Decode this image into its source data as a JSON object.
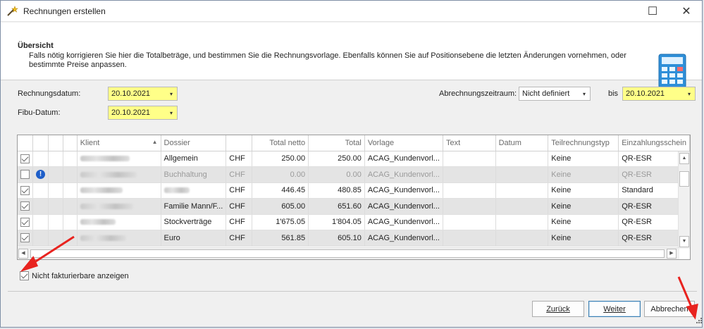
{
  "window": {
    "title": "Rechnungen erstellen",
    "maximize_glyph": "☐",
    "close_glyph": "✕"
  },
  "header": {
    "title": "Übersicht",
    "text": "Falls nötig korrigieren Sie hier die Totalbeträge, und bestimmen Sie die Rechnungsvorlage. Ebenfalls können Sie auf Positionsebene die letzten Änderungen vornehmen, oder bestimmte Preise anpassen."
  },
  "form": {
    "rechnungsdatum_label": "Rechnungsdatum:",
    "rechnungsdatum_value": "20.10.2021",
    "fibu_label": "Fibu-Datum:",
    "fibu_value": "20.10.2021",
    "zeitraum_label": "Abrechnungszeitraum:",
    "zeitraum_value": "Nicht definiert",
    "bis_label": "bis",
    "bis_value": "20.10.2021",
    "dropdown_glyph": "▾"
  },
  "grid": {
    "columns": [
      "Klient",
      "Dossier",
      "",
      "Total netto",
      "Total",
      "Vorlage",
      "Text",
      "Datum",
      "Teilrechnungstyp",
      "Einzahlungsschein"
    ],
    "sort_glyph": "▲",
    "rows": [
      {
        "checked": true,
        "info": false,
        "dossier": "Allgemein",
        "cur": "CHF",
        "netto": "250.00",
        "total": "250.00",
        "vorlage": "ACAG_Kundenvorl...",
        "teil": "Keine",
        "ez": "QR-ESR"
      },
      {
        "checked": false,
        "info": true,
        "dossier": "Buchhaltung",
        "cur": "CHF",
        "netto": "0.00",
        "total": "0.00",
        "vorlage": "ACAG_Kundenvorl...",
        "teil": "Keine",
        "ez": "QR-ESR"
      },
      {
        "checked": true,
        "info": false,
        "dossier": "",
        "cur": "CHF",
        "netto": "446.45",
        "total": "480.85",
        "vorlage": "ACAG_Kundenvorl...",
        "teil": "Keine",
        "ez": "Standard"
      },
      {
        "checked": true,
        "info": false,
        "dossier": "Familie Mann/F...",
        "cur": "CHF",
        "netto": "605.00",
        "total": "651.60",
        "vorlage": "ACAG_Kundenvorl...",
        "teil": "Keine",
        "ez": "QR-ESR"
      },
      {
        "checked": true,
        "info": false,
        "dossier": "Stockverträge",
        "cur": "CHF",
        "netto": "1'675.05",
        "total": "1'804.05",
        "vorlage": "ACAG_Kundenvorl...",
        "teil": "Keine",
        "ez": "QR-ESR"
      },
      {
        "checked": true,
        "info": false,
        "dossier": "Euro",
        "cur": "CHF",
        "netto": "561.85",
        "total": "605.10",
        "vorlage": "ACAG_Kundenvorl...",
        "teil": "Keine",
        "ez": "QR-ESR"
      }
    ]
  },
  "options": {
    "nicht_fakturierbare_label": "Nicht fakturierbare anzeigen",
    "nicht_fakturierbare_checked": true
  },
  "buttons": {
    "back": "Zurück",
    "next": "Weiter",
    "cancel": "Abbrechen"
  },
  "colors": {
    "annotation_arrow": "#e8231f",
    "required_field": "#ffff88"
  }
}
